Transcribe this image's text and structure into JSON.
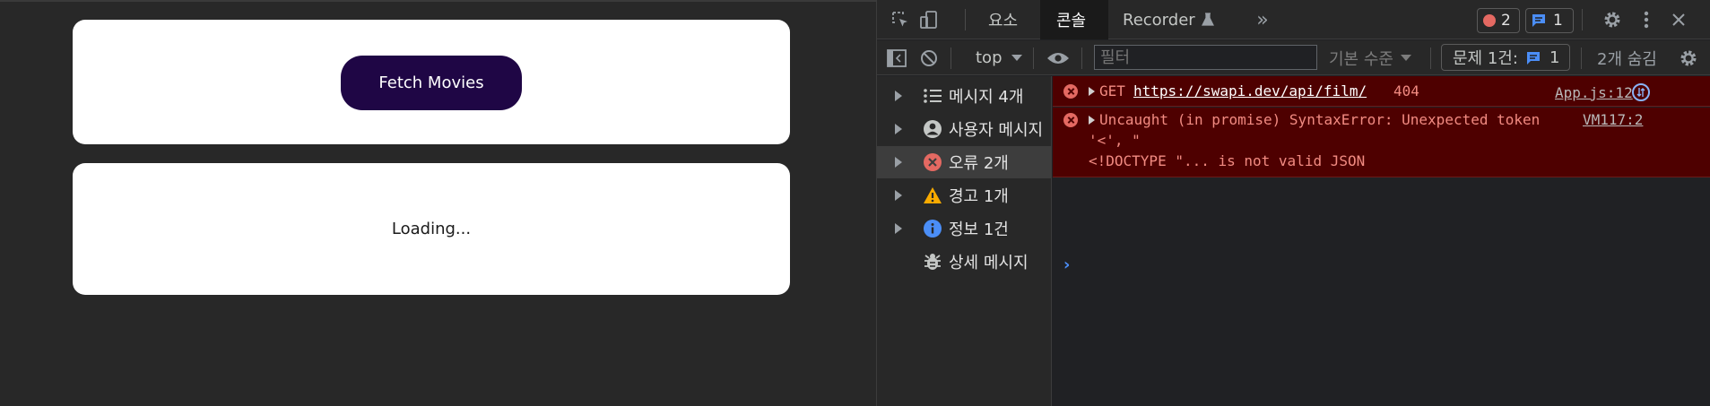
{
  "app": {
    "fetch_button_label": "Fetch Movies",
    "loading_text": "Loading..."
  },
  "devtools": {
    "tabs": [
      {
        "label": "요소"
      },
      {
        "label": "콘솔"
      },
      {
        "label": "Recorder"
      }
    ],
    "error_badge_count": "2",
    "message_badge_count": "1",
    "toolbar": {
      "context": "top",
      "filter_placeholder": "필터",
      "level": "기본 수준",
      "issues_label": "문제 1건:",
      "issues_count": "1",
      "hidden_label": "2개 숨김"
    },
    "sidebar": {
      "items": [
        {
          "label": "메시지 4개",
          "icon": "list-icon"
        },
        {
          "label": "사용자 메시지",
          "icon": "user-icon"
        },
        {
          "label": "오류 2개",
          "icon": "error-icon"
        },
        {
          "label": "경고 1개",
          "icon": "warning-icon"
        },
        {
          "label": "정보 1건",
          "icon": "info-icon"
        },
        {
          "label": "상세 메시지",
          "icon": "bug-icon"
        }
      ]
    },
    "console": {
      "messages": [
        {
          "method": "GET",
          "url": "https://swapi.dev/api/film/",
          "status": "404",
          "source": "App.js:12"
        },
        {
          "line1": "Uncaught (in promise) SyntaxError: Unexpected token",
          "line2": "'<', \"",
          "line3": "<!DOCTYPE \"... is not valid JSON",
          "source": "VM117:2"
        }
      ]
    },
    "colors": {
      "error_bg": "#4e0000",
      "error_text": "#f28b82",
      "button_bg": "#1f0645",
      "accent_blue": "#4b8ef7"
    }
  }
}
